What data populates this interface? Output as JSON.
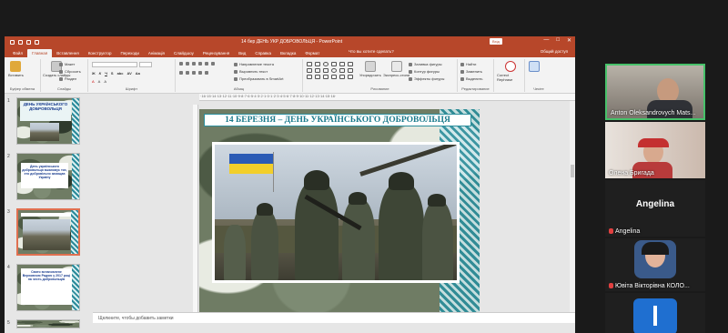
{
  "ppt": {
    "title": "14 бер ДЕНЬ УКР ДОБРОВОЛЬЦЯ - PowerPoint",
    "signin": "Вхід",
    "tabs": [
      "Файл",
      "Главная",
      "Вставлення",
      "Конструктор",
      "Переходи",
      "Анімація",
      "Слайдшоу",
      "Рецензування",
      "Вид",
      "Справка",
      "Вкладка",
      "Формат"
    ],
    "tell_me": "Что вы хотите сделать?",
    "share": "Общий доступ",
    "ribbon": {
      "paste": "Вставить",
      "slide_new": "Создать слайды",
      "layout": "Макет",
      "reset": "Сбросить",
      "section": "Раздел",
      "clipboard": "Буфер обмена",
      "slides": "Слайды",
      "font": "Шрифт",
      "paragraph": "Абзац",
      "text_dir": "Направление текста",
      "align_text": "Выровнять текст",
      "smartart": "Преобразовать в SmartArt",
      "arrange": "Упорядочить",
      "quick_styles": "Экспресс-стили",
      "shape_fill": "Заливка фигуры",
      "shape_outline": "Контур фигуры",
      "shape_effects": "Эффекты фигуры",
      "drawing": "Рисование",
      "find": "Найти",
      "replace": "Заменить",
      "select": "Выделить",
      "editing": "Редактирование",
      "rephrase": "Correct Rephrase",
      "group_edit": "Чекіте"
    },
    "thumbnails": [
      {
        "num": "1",
        "text": "ДЕНЬ УКРАЇНСЬКОГО ДОБРОВОЛЬЦЯ"
      },
      {
        "num": "2",
        "text": "День українського добровольця вшановує тих, хто добровільно захищав Україну"
      },
      {
        "num": "3",
        "text": ""
      },
      {
        "num": "4",
        "text": "Свято встановлене Верховною Радою у 2017 році на честь добровольців"
      },
      {
        "num": "5",
        "text": ""
      }
    ],
    "slide_title": "14 БЕРЕЗНЯ – ДЕНЬ УКРАЇНСЬКОГО ДОБРОВОЛЬЦЯ",
    "notes_placeholder": "Щелкните, чтобы добавить заметки"
  },
  "participants": [
    {
      "name": "Anton Oleksandrovych Mats...",
      "muted": false
    },
    {
      "name": "Олена Бригада",
      "muted": false
    },
    {
      "name": "Angelina",
      "big_label": "Angelina",
      "muted": true
    },
    {
      "name": "Ювіта Вікторівна КОЛО...",
      "muted": true
    },
    {
      "name": "",
      "muted": false
    }
  ]
}
